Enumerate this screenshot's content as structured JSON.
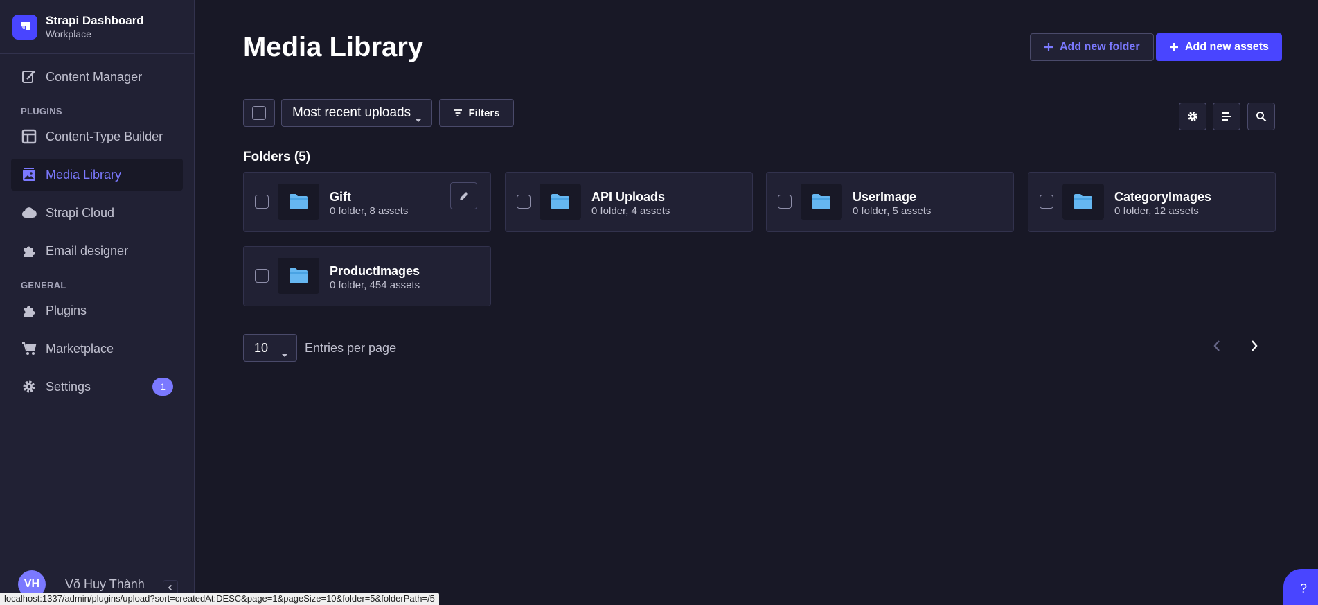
{
  "brand": {
    "title": "Strapi Dashboard",
    "subtitle": "Workplace"
  },
  "sidebar": {
    "content_manager": "Content Manager",
    "plugins_section": "PLUGINS",
    "plugin_items": [
      {
        "label": "Content-Type Builder",
        "icon": "layout-icon"
      },
      {
        "label": "Media Library",
        "icon": "image-icon",
        "active": true
      },
      {
        "label": "Strapi Cloud",
        "icon": "cloud-icon"
      },
      {
        "label": "Email designer",
        "icon": "puzzle-icon"
      }
    ],
    "general_section": "GENERAL",
    "general_items": [
      {
        "label": "Plugins",
        "icon": "puzzle-icon"
      },
      {
        "label": "Marketplace",
        "icon": "cart-icon"
      },
      {
        "label": "Settings",
        "icon": "gear-icon",
        "badge": "1"
      }
    ],
    "user": {
      "initials": "VH",
      "name": "Võ Huy Thành"
    }
  },
  "header": {
    "title": "Media Library",
    "add_folder": "Add new folder",
    "add_assets": "Add new assets"
  },
  "toolbar": {
    "sort_value": "Most recent uploads",
    "filters": "Filters"
  },
  "folders": {
    "title": "Folders (5)",
    "items": [
      {
        "name": "Gift",
        "meta": "0 folder, 8 assets"
      },
      {
        "name": "API Uploads",
        "meta": "0 folder, 4 assets"
      },
      {
        "name": "UserImage",
        "meta": "0 folder, 5 assets"
      },
      {
        "name": "CategoryImages",
        "meta": "0 folder, 12 assets"
      },
      {
        "name": "ProductImages",
        "meta": "0 folder, 454 assets"
      }
    ]
  },
  "pagination": {
    "page_size": "10",
    "label": "Entries per page"
  },
  "help": "?",
  "status_url": "localhost:1337/admin/plugins/upload?sort=createdAt:DESC&page=1&pageSize=10&folder=5&folderPath=/5",
  "colors": {
    "accent": "#4945ff",
    "accent_light": "#7b79ff",
    "bg": "#181826",
    "panel": "#212134",
    "folder": "#66b7f1"
  }
}
